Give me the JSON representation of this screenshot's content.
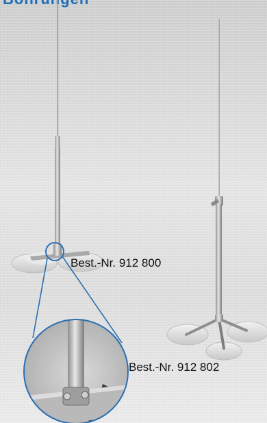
{
  "heading": {
    "text": "Bohrungen"
  },
  "products": [
    {
      "label": "Best.-Nr. 912 800"
    },
    {
      "label": "Best.-Nr. 912 802"
    }
  ],
  "colors": {
    "heading_blue": "#1d6fb8",
    "background_grey": "#dcdcdc",
    "detail_circle_border": "#2a6fb0",
    "callout_line": "#2a6fb0"
  }
}
